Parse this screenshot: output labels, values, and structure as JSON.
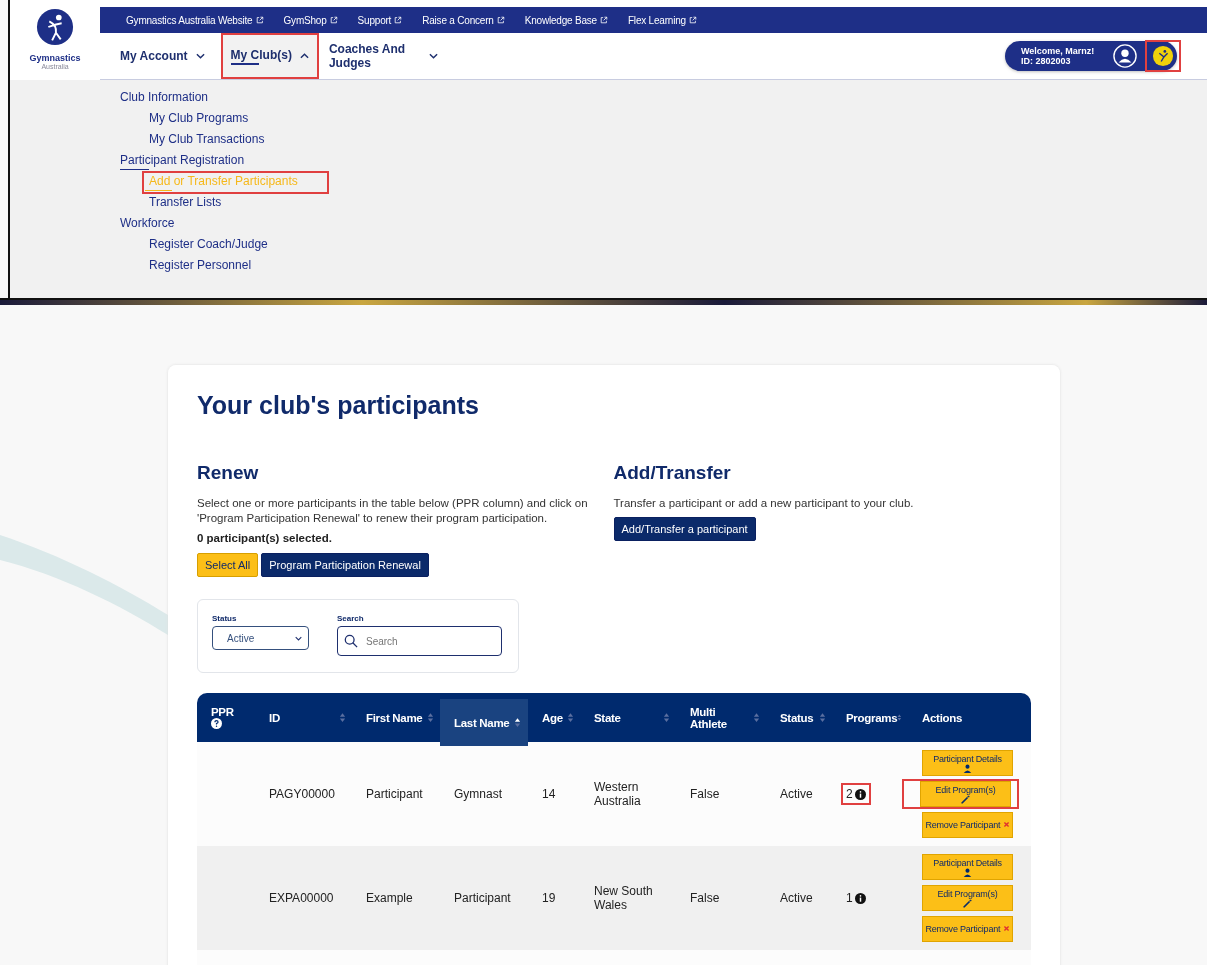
{
  "top_links": [
    {
      "label": "Gymnastics Australia Website"
    },
    {
      "label": "GymShop"
    },
    {
      "label": "Support"
    },
    {
      "label": "Raise a Concern"
    },
    {
      "label": "Knowledge Base"
    },
    {
      "label": "Flex Learning"
    }
  ],
  "logo": {
    "name": "Gymnastics",
    "sub": "Australia"
  },
  "nav": [
    {
      "label": "My Account",
      "selected": false,
      "highlighted": false
    },
    {
      "label": "My Club(s)",
      "selected": true,
      "highlighted": true
    },
    {
      "label": "Coaches And Judges",
      "selected": false,
      "highlighted": false
    }
  ],
  "user": {
    "welcome": "Welcome, Marnz!",
    "id": "ID: 2802003",
    "badge_highlighted": true
  },
  "menu": [
    {
      "label": "Club Information",
      "selected": false,
      "children": [
        {
          "label": "My Club Programs",
          "selected": false,
          "highlighted": false
        },
        {
          "label": "My Club Transactions",
          "selected": false,
          "highlighted": false
        }
      ]
    },
    {
      "label": "Participant Registration",
      "selected": true,
      "children": [
        {
          "label": "Add or Transfer Participants",
          "selected": true,
          "highlighted": true
        },
        {
          "label": "Transfer Lists",
          "selected": false,
          "highlighted": false
        }
      ]
    },
    {
      "label": "Workforce",
      "selected": false,
      "children": [
        {
          "label": "Register Coach/Judge",
          "selected": false,
          "highlighted": false
        },
        {
          "label": "Register Personnel",
          "selected": false,
          "highlighted": false
        }
      ]
    }
  ],
  "page_title": "Your club's participants",
  "renew": {
    "heading": "Renew",
    "text": "Select one or more participants in the table below (PPR column) and click on 'Program Participation Renewal' to renew their program participation.",
    "selected_count": "0 participant(s) selected.",
    "buttons": [
      {
        "label": "Select All",
        "kind": "primary"
      },
      {
        "label": "Program Participation Renewal",
        "kind": "dark"
      }
    ]
  },
  "add_transfer": {
    "heading": "Add/Transfer",
    "text": "Transfer a participant or add a new participant to your club.",
    "button": "Add/Transfer a participant"
  },
  "filters": {
    "status_label": "Status",
    "status_value": "Active",
    "search_label": "Search",
    "search_placeholder": "Search"
  },
  "table": {
    "columns": [
      {
        "label": "PPR",
        "kind": "help",
        "selected": false
      },
      {
        "label": "ID",
        "kind": "sortable",
        "selected": false
      },
      {
        "label": "First Name",
        "kind": "sortable",
        "selected": false
      },
      {
        "label": "Last Name",
        "kind": "sortable",
        "selected": true
      },
      {
        "label": "Age",
        "kind": "sortable",
        "selected": false
      },
      {
        "label": "State",
        "kind": "sortable",
        "selected": false
      },
      {
        "label": "Multi Athlete",
        "kind": "sortable",
        "selected": false
      },
      {
        "label": "Status",
        "kind": "sortable",
        "selected": false
      },
      {
        "label": "Programs",
        "kind": "sortable",
        "selected": false
      },
      {
        "label": "Actions",
        "kind": "plain",
        "selected": false
      }
    ],
    "rows": [
      {
        "id": "PAGY00000",
        "first": "Participant",
        "last": "Gymnast",
        "age": "14",
        "state": "Western Australia",
        "multi": "False",
        "status": "Active",
        "programs": "2",
        "programs_highlighted": true,
        "actions": [
          {
            "label": "Participant Details",
            "kind": "details",
            "highlighted": false
          },
          {
            "label": "Edit Program(s)",
            "kind": "edit",
            "highlighted": true
          },
          {
            "label": "Remove Participant",
            "kind": "remove",
            "highlighted": false
          }
        ]
      },
      {
        "id": "EXPA00000",
        "first": "Example",
        "last": "Participant",
        "age": "19",
        "state": "New South Wales",
        "multi": "False",
        "status": "Active",
        "programs": "1",
        "programs_highlighted": false,
        "actions": [
          {
            "label": "Participant Details",
            "kind": "details",
            "highlighted": false
          },
          {
            "label": "Edit Program(s)",
            "kind": "edit",
            "highlighted": false
          },
          {
            "label": "Remove Participant",
            "kind": "remove",
            "highlighted": false
          }
        ]
      }
    ]
  }
}
